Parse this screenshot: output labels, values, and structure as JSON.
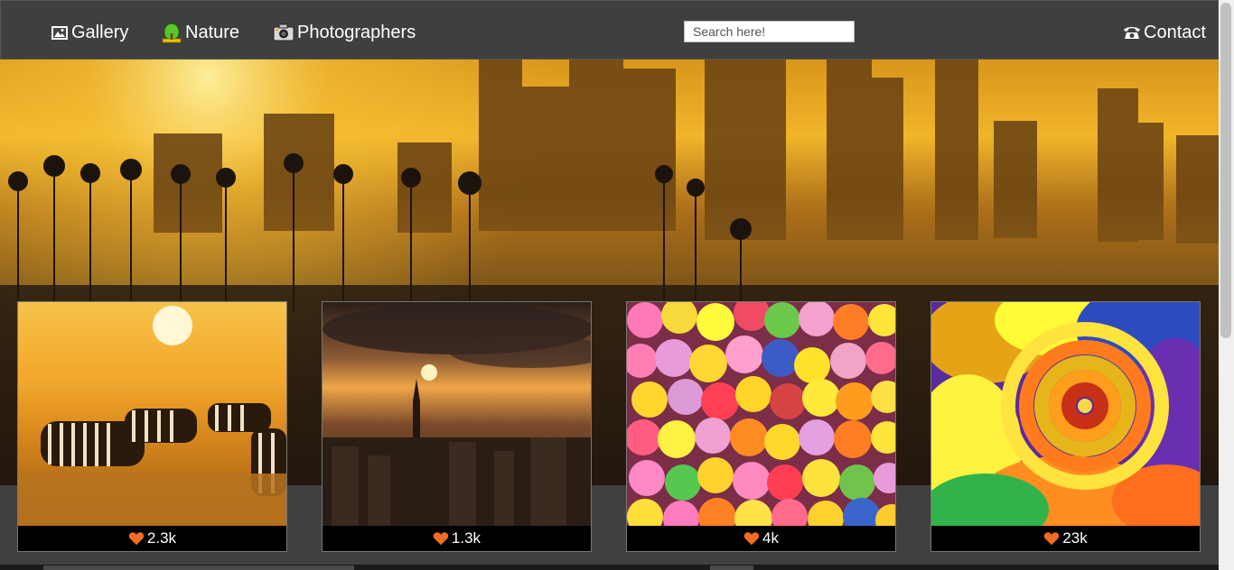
{
  "nav": {
    "gallery_label": "Gallery",
    "nature_label": "Nature",
    "photographers_label": "Photographers",
    "contact_label": "Contact",
    "search_placeholder": "Search here!",
    "icons": {
      "gallery": "picture-frame-icon",
      "nature": "tree-icon",
      "photographers": "camera-icon",
      "contact": "telephone-icon"
    }
  },
  "hero": {
    "image": "sunset-city-skyline-with-palm-trees"
  },
  "cards": [
    {
      "image": "zebras-savanna-sunset",
      "likes": "2.3k"
    },
    {
      "image": "city-tower-sunset",
      "likes": "1.3k"
    },
    {
      "image": "colorful-candies",
      "likes": "4k"
    },
    {
      "image": "rainbow-rose",
      "likes": "23k"
    }
  ],
  "colors": {
    "navbar_bg": "#3f3f3f",
    "page_bg": "#404040",
    "heart": "#f36d1f",
    "text": "#ffffff"
  }
}
